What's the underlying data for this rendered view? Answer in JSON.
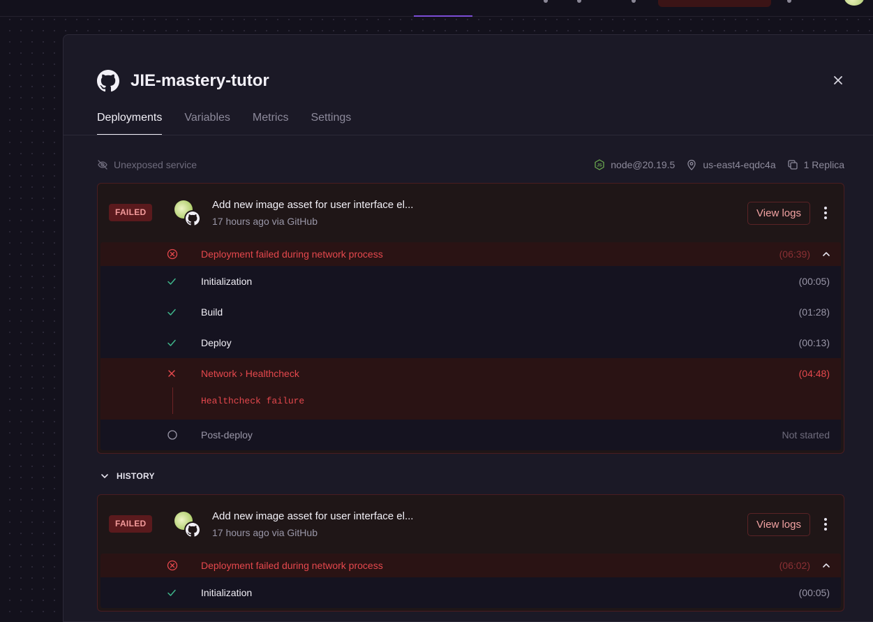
{
  "service": {
    "name": "JIE-mastery-tutor",
    "tabs": [
      {
        "label": "Deployments",
        "active": true
      },
      {
        "label": "Variables"
      },
      {
        "label": "Metrics"
      },
      {
        "label": "Settings"
      }
    ],
    "close_icon": "close-icon"
  },
  "meta": {
    "exposure": "Unexposed service",
    "runtime": "node@20.19.5",
    "region": "us-east4-eqdc4a",
    "replicas": "1 Replica"
  },
  "active_deployment": {
    "status": "FAILED",
    "commit_message": "Add new image asset for user interface el...",
    "subtitle": "17 hours ago via GitHub",
    "view_logs": "View logs",
    "failure": {
      "text": "Deployment failed during network process",
      "time": "(06:39)"
    },
    "steps": [
      {
        "name": "Initialization",
        "time": "(00:05)",
        "state": "success"
      },
      {
        "name": "Build",
        "time": "(01:28)",
        "state": "success"
      },
      {
        "name": "Deploy",
        "time": "(00:13)",
        "state": "success"
      },
      {
        "name": "Network › Healthcheck",
        "time": "(04:48)",
        "state": "error",
        "message": "Healthcheck failure"
      },
      {
        "name": "Post-deploy",
        "time": "Not started",
        "state": "pending"
      }
    ]
  },
  "history": {
    "label": "HISTORY",
    "items": [
      {
        "status": "FAILED",
        "commit_message": "Add new image asset for user interface el...",
        "subtitle": "17 hours ago via GitHub",
        "view_logs": "View logs",
        "failure": {
          "text": "Deployment failed during network process",
          "time": "(06:02)"
        },
        "steps": [
          {
            "name": "Initialization",
            "time": "(00:05)",
            "state": "success"
          }
        ]
      }
    ]
  },
  "colors": {
    "background": "#13111c",
    "panel": "#1b1926",
    "error": "#e5484d",
    "success": "#3fb68b",
    "accent": "#7c4dd6"
  }
}
